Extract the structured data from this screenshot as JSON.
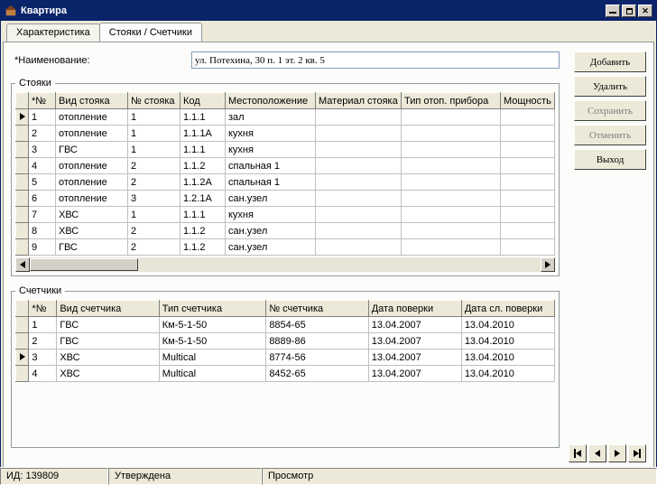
{
  "window": {
    "title": "Квартира"
  },
  "tabs": {
    "characteristics": "Характеристика",
    "risers": "Стояки / Счетчики"
  },
  "name_field": {
    "label": "*Наименование:",
    "value": "ул. Потехина, 30 п. 1 эт. 2 кв. 5"
  },
  "buttons": {
    "add": "Добавить",
    "delete": "Удалить",
    "save": "Сохранить",
    "cancel": "Отменить",
    "exit": "Выход"
  },
  "risers_group": {
    "legend": "Стояки",
    "columns": [
      "*№",
      "Вид стояка",
      "№ стояка",
      "Код",
      "Местоположение",
      "Материал стояка",
      "Тип отоп. прибора",
      "Мощность"
    ],
    "selected_row": 0,
    "rows": [
      {
        "n": 1,
        "type": "отопление",
        "num": 1,
        "code": "1.1.1",
        "loc": "зал",
        "mat": "",
        "htype": "",
        "pwr": ""
      },
      {
        "n": 2,
        "type": "отопление",
        "num": 1,
        "code": "1.1.1А",
        "loc": "кухня",
        "mat": "",
        "htype": "",
        "pwr": ""
      },
      {
        "n": 3,
        "type": "ГВС",
        "num": 1,
        "code": "1.1.1",
        "loc": "кухня",
        "mat": "",
        "htype": "",
        "pwr": ""
      },
      {
        "n": 4,
        "type": "отопление",
        "num": 2,
        "code": "1.1.2",
        "loc": "спальная 1",
        "mat": "",
        "htype": "",
        "pwr": ""
      },
      {
        "n": 5,
        "type": "отопление",
        "num": 2,
        "code": "1.1.2А",
        "loc": "спальная 1",
        "mat": "",
        "htype": "",
        "pwr": ""
      },
      {
        "n": 6,
        "type": "отопление",
        "num": 3,
        "code": "1.2.1А",
        "loc": "сан.узел",
        "mat": "",
        "htype": "",
        "pwr": ""
      },
      {
        "n": 7,
        "type": "ХВС",
        "num": 1,
        "code": "1.1.1",
        "loc": "кухня",
        "mat": "",
        "htype": "",
        "pwr": ""
      },
      {
        "n": 8,
        "type": "ХВС",
        "num": 2,
        "code": "1.1.2",
        "loc": "сан.узел",
        "mat": "",
        "htype": "",
        "pwr": ""
      },
      {
        "n": 9,
        "type": "ГВС",
        "num": 2,
        "code": "1.1.2",
        "loc": "сан.узел",
        "mat": "",
        "htype": "",
        "pwr": ""
      }
    ]
  },
  "meters_group": {
    "legend": "Счетчики",
    "columns": [
      "*№",
      "Вид счетчика",
      "Тип счетчика",
      "№ счетчика",
      "Дата поверки",
      "Дата сл. поверки"
    ],
    "selected_row": 2,
    "rows": [
      {
        "n": 1,
        "kind": "ГВС",
        "mtype": "Км-5-1-50",
        "mnum": "8854-65",
        "d1": "13.04.2007",
        "d2": "13.04.2010"
      },
      {
        "n": 2,
        "kind": "ГВС",
        "mtype": "Км-5-1-50",
        "mnum": "8889-86",
        "d1": "13.04.2007",
        "d2": "13.04.2010"
      },
      {
        "n": 3,
        "kind": "ХВС",
        "mtype": "Multical",
        "mnum": "8774-56",
        "d1": "13.04.2007",
        "d2": "13.04.2010"
      },
      {
        "n": 4,
        "kind": "ХВС",
        "mtype": "Multical",
        "mnum": "8452-65",
        "d1": "13.04.2007",
        "d2": "13.04.2010"
      }
    ]
  },
  "statusbar": {
    "id_label": "ИД: 139809",
    "status": "Утверждена",
    "mode": "Просмотр"
  }
}
